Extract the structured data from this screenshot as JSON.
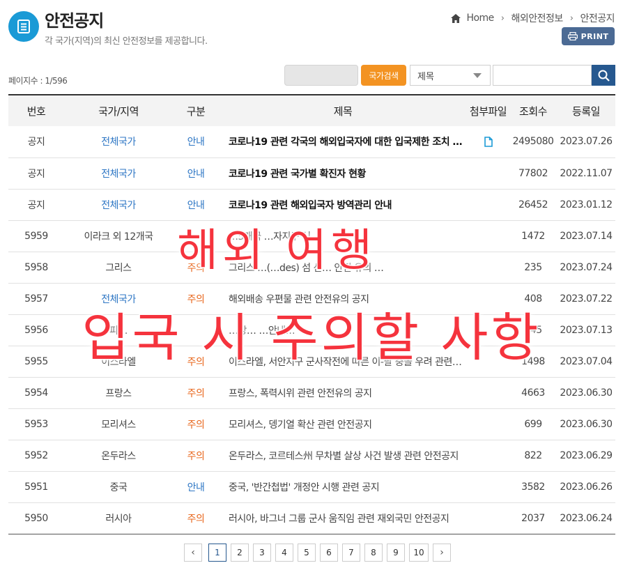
{
  "header": {
    "title": "안전공지",
    "subtitle": "각 국가(지역)의 최신 안전정보를 제공합니다.",
    "breadcrumb": [
      "Home",
      "해외안전정보",
      "안전공지"
    ],
    "print_label": "PRINT"
  },
  "toolbar": {
    "page_count": "페이지수 : 1/596",
    "country_search_label": "국가검색",
    "field_select_value": "제목",
    "search_value": "",
    "accent_color": "#f39322",
    "primary_color": "#26588f"
  },
  "table": {
    "columns": [
      "번호",
      "국가/지역",
      "구분",
      "제목",
      "첨부파일",
      "조회수",
      "등록일"
    ],
    "rows": [
      {
        "no": "공지",
        "country": "전체국가",
        "category": "안내",
        "title": "코로나19 관련 각국의 해외입국자에 대한 입국제한 조치 …",
        "attachment": "file-icon",
        "views": "2495080",
        "date": "2023.07.26",
        "notice": true
      },
      {
        "no": "공지",
        "country": "전체국가",
        "category": "안내",
        "title": "코로나19 관련 국가별 확진자 현황",
        "attachment": "",
        "views": "77802",
        "date": "2022.11.07",
        "notice": true
      },
      {
        "no": "공지",
        "country": "전체국가",
        "category": "안내",
        "title": "코로나19 관련 해외입국자 방역관리 안내",
        "attachment": "",
        "views": "26452",
        "date": "2023.01.12",
        "notice": true
      },
      {
        "no": "5959",
        "country": "이라크 외 12개국",
        "category": "",
        "title": "…5개국 …자지구 신…",
        "attachment": "",
        "views": "1472",
        "date": "2023.07.14",
        "notice": false
      },
      {
        "no": "5958",
        "country": "그리스",
        "category": "주의",
        "title": "그리스 …(…des) 섬 산… 안전 유의 …",
        "attachment": "",
        "views": "235",
        "date": "2023.07.24",
        "notice": false
      },
      {
        "no": "5957",
        "country": "전체국가",
        "category": "주의",
        "title": "해외배송 우편물 관련 안전유의 공지",
        "attachment": "",
        "views": "408",
        "date": "2023.07.22",
        "notice": false
      },
      {
        "no": "5956",
        "country": "피…",
        "category": "",
        "title": "…방… …안내…",
        "attachment": "",
        "views": "745",
        "date": "2023.07.13",
        "notice": false
      },
      {
        "no": "5955",
        "country": "이스라엘",
        "category": "주의",
        "title": "이스라엘, 서안지구 군사작전에 따른 이-팔 충돌 우려 관련…",
        "attachment": "",
        "views": "1498",
        "date": "2023.07.04",
        "notice": false
      },
      {
        "no": "5954",
        "country": "프랑스",
        "category": "주의",
        "title": "프랑스, 폭력시위 관련 안전유의 공지",
        "attachment": "",
        "views": "4663",
        "date": "2023.06.30",
        "notice": false
      },
      {
        "no": "5953",
        "country": "모리셔스",
        "category": "주의",
        "title": "모리셔스, 뎅기열 확산 관련 안전공지",
        "attachment": "",
        "views": "699",
        "date": "2023.06.30",
        "notice": false
      },
      {
        "no": "5952",
        "country": "온두라스",
        "category": "주의",
        "title": "온두라스, 코르테스州 무차별 살상 사건 발생 관련 안전공지",
        "attachment": "",
        "views": "822",
        "date": "2023.06.29",
        "notice": false
      },
      {
        "no": "5951",
        "country": "중국",
        "category": "안내",
        "title": "중국, '반간첩법' 개정안 시행 관련 공지",
        "attachment": "",
        "views": "3582",
        "date": "2023.06.26",
        "notice": false
      },
      {
        "no": "5950",
        "country": "러시아",
        "category": "주의",
        "title": "러시아, 바그너 그룹 군사 움직임 관련 재외국민 안전공지",
        "attachment": "",
        "views": "2037",
        "date": "2023.06.24",
        "notice": false
      }
    ]
  },
  "pagination": {
    "pages": [
      "1",
      "2",
      "3",
      "4",
      "5",
      "6",
      "7",
      "8",
      "9",
      "10"
    ],
    "current": "1",
    "prev_icon": "chevron-left-icon",
    "next_icon": "chevron-right-icon"
  },
  "overlay": {
    "line1": "해외 여행",
    "line2": "입국 시 주의할 사항",
    "color": "#f5333d"
  }
}
